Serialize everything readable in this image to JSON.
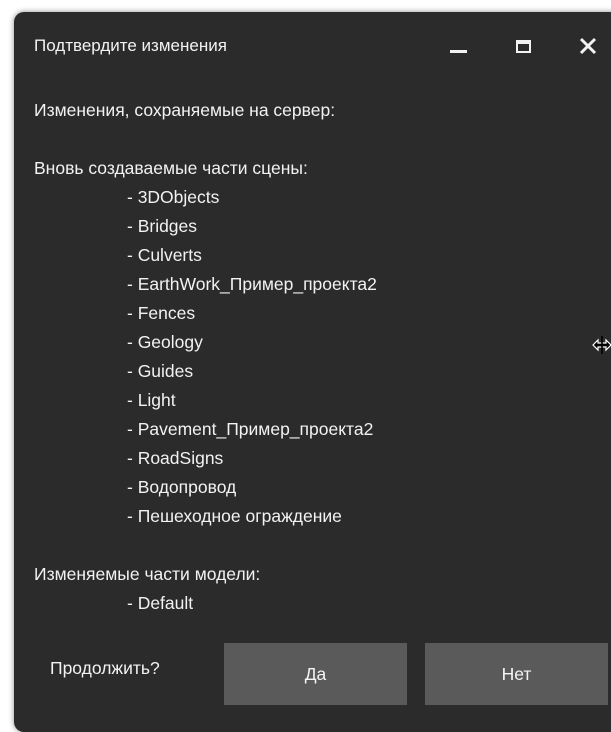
{
  "dialog": {
    "title": "Подтвердите изменения",
    "controls": {
      "minimize_icon": "minimize-icon",
      "maximize_icon": "maximize-icon",
      "close_label": "✕"
    },
    "intro": "Изменения, сохраняемые на сервер:",
    "new_parts_heading": "Вновь создаваемые части сцены:",
    "new_parts": [
      "- 3DObjects",
      "- Bridges",
      "- Culverts",
      "- EarthWork_Пример_проекта2",
      "- Fences",
      "- Geology",
      "- Guides",
      "- Light",
      "- Pavement_Пример_проекта2",
      "- RoadSigns",
      "- Водопровод",
      "- Пешеходное ограждение"
    ],
    "modified_parts_heading": "Изменяемые части модели:",
    "modified_parts": [
      "- Default"
    ],
    "question": "Продолжить?",
    "yes_label": "Да",
    "no_label": "Нет"
  },
  "colors": {
    "window_bg": "#2b2b2b",
    "button_bg": "#5a5a5a",
    "text": "#f2f2f2"
  }
}
